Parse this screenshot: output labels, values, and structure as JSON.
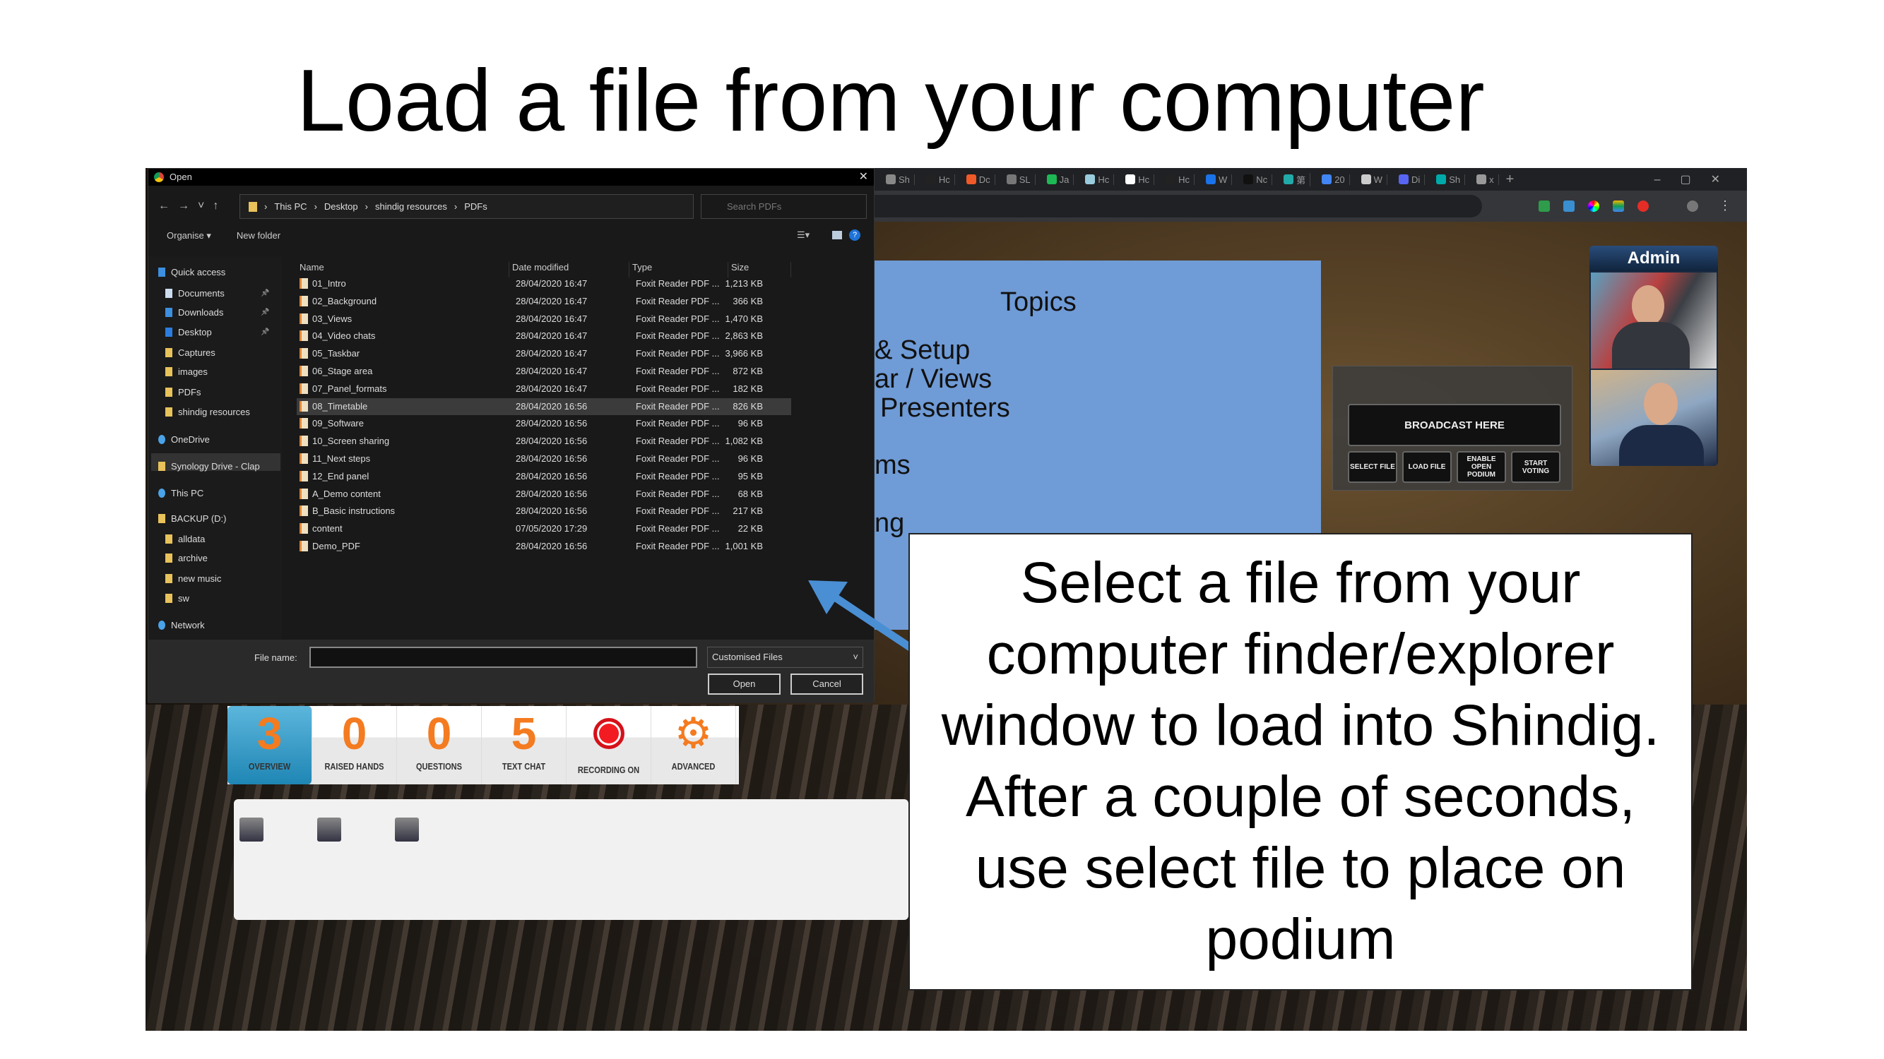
{
  "slide_title": "Load a file from your computer",
  "callout": {
    "lines": [
      "Select a file from your",
      "computer finder/explorer",
      "window to load into Shindig.",
      "After a couple of seconds,",
      "use select file to place on",
      "podium"
    ]
  },
  "colors": {
    "arrow": "#4a8fd4",
    "accent_orange": "#f47b20",
    "overview_blue": "#2a96c4",
    "slide_blue": "#6f9bd6"
  },
  "browser": {
    "tabs": [
      "Sh",
      "Hc",
      "Dc",
      "SL",
      "Ja",
      "Hc",
      "Hc",
      "Hc",
      "W",
      "Nc",
      "第",
      "20",
      "W",
      "Di",
      "Sh"
    ],
    "active_tab_close": "x",
    "new_tab": "+"
  },
  "dialog": {
    "title": "Open",
    "breadcrumb": [
      "This PC",
      "Desktop",
      "shindig resources",
      "PDFs"
    ],
    "search_placeholder": "Search PDFs",
    "organise": "Organise ▾",
    "new_folder": "New folder",
    "columns": {
      "name": "Name",
      "date": "Date modified",
      "type": "Type",
      "size": "Size"
    },
    "nav": [
      {
        "label": "Quick access",
        "icon": "star-icon"
      },
      {
        "label": "Documents",
        "icon": "documents-icon",
        "pinned": true
      },
      {
        "label": "Downloads",
        "icon": "download-icon",
        "pinned": true
      },
      {
        "label": "Desktop",
        "icon": "desktop-icon",
        "pinned": true
      },
      {
        "label": "Captures",
        "icon": "folder-icon"
      },
      {
        "label": "images",
        "icon": "folder-icon"
      },
      {
        "label": "PDFs",
        "icon": "folder-icon"
      },
      {
        "label": "shindig resources",
        "icon": "folder-icon"
      },
      {
        "label": "OneDrive",
        "icon": "cloud-icon"
      },
      {
        "label": "Synology Drive - Clap",
        "icon": "drive-icon"
      },
      {
        "label": "This PC",
        "icon": "computer-icon",
        "selected": true
      },
      {
        "label": "BACKUP (D:)",
        "icon": "disk-icon"
      },
      {
        "label": "alldata",
        "icon": "folder-icon"
      },
      {
        "label": "archive",
        "icon": "folder-icon"
      },
      {
        "label": "new music",
        "icon": "folder-icon"
      },
      {
        "label": "sw",
        "icon": "folder-icon"
      },
      {
        "label": "Network",
        "icon": "network-icon"
      }
    ],
    "files": [
      {
        "name": "01_Intro",
        "date": "28/04/2020 16:47",
        "type": "Foxit Reader PDF ...",
        "size": "1,213 KB"
      },
      {
        "name": "02_Background",
        "date": "28/04/2020 16:47",
        "type": "Foxit Reader PDF ...",
        "size": "366 KB"
      },
      {
        "name": "03_Views",
        "date": "28/04/2020 16:47",
        "type": "Foxit Reader PDF ...",
        "size": "1,470 KB"
      },
      {
        "name": "04_Video chats",
        "date": "28/04/2020 16:47",
        "type": "Foxit Reader PDF ...",
        "size": "2,863 KB"
      },
      {
        "name": "05_Taskbar",
        "date": "28/04/2020 16:47",
        "type": "Foxit Reader PDF ...",
        "size": "3,966 KB"
      },
      {
        "name": "06_Stage area",
        "date": "28/04/2020 16:47",
        "type": "Foxit Reader PDF ...",
        "size": "872 KB"
      },
      {
        "name": "07_Panel_formats",
        "date": "28/04/2020 16:47",
        "type": "Foxit Reader PDF ...",
        "size": "182 KB"
      },
      {
        "name": "08_Timetable",
        "date": "28/04/2020 16:56",
        "type": "Foxit Reader PDF ...",
        "size": "826 KB",
        "selected": true
      },
      {
        "name": "09_Software",
        "date": "28/04/2020 16:56",
        "type": "Foxit Reader PDF ...",
        "size": "96 KB"
      },
      {
        "name": "10_Screen sharing",
        "date": "28/04/2020 16:56",
        "type": "Foxit Reader PDF ...",
        "size": "1,082 KB"
      },
      {
        "name": "11_Next steps",
        "date": "28/04/2020 16:56",
        "type": "Foxit Reader PDF ...",
        "size": "96 KB"
      },
      {
        "name": "12_End panel",
        "date": "28/04/2020 16:56",
        "type": "Foxit Reader PDF ...",
        "size": "95 KB"
      },
      {
        "name": "A_Demo content",
        "date": "28/04/2020 16:56",
        "type": "Foxit Reader PDF ...",
        "size": "68 KB"
      },
      {
        "name": "B_Basic instructions",
        "date": "28/04/2020 16:56",
        "type": "Foxit Reader PDF ...",
        "size": "217 KB"
      },
      {
        "name": "content",
        "date": "07/05/2020 17:29",
        "type": "Foxit Reader PDF ...",
        "size": "22 KB"
      },
      {
        "name": "Demo_PDF",
        "date": "28/04/2020 16:56",
        "type": "Foxit Reader PDF ...",
        "size": "1,001 KB"
      }
    ],
    "file_name_label": "File name:",
    "file_name_value": "",
    "filter": "Customised Files",
    "open": "Open",
    "cancel": "Cancel"
  },
  "shindig": {
    "slide": {
      "title": "Topics",
      "lines": [
        "& Setup",
        "ar / Views",
        "Presenters",
        "ms",
        "ng"
      ]
    },
    "broadcast": "BROADCAST HERE",
    "buttons": [
      "SELECT FILE",
      "LOAD FILE",
      "ENABLE OPEN PODIUM",
      "START VOTING"
    ],
    "admin_label": "Admin",
    "toolbar": [
      {
        "value": "3",
        "label": "OVERVIEW",
        "active": true
      },
      {
        "value": "0",
        "label": "RAISED HANDS"
      },
      {
        "value": "0",
        "label": "QUESTIONS"
      },
      {
        "value": "5",
        "label": "TEXT CHAT"
      },
      {
        "icon": "record-icon",
        "label": "RECORDING ON"
      },
      {
        "icon": "gear-icon",
        "label": "ADVANCED"
      }
    ],
    "participants": 3
  }
}
